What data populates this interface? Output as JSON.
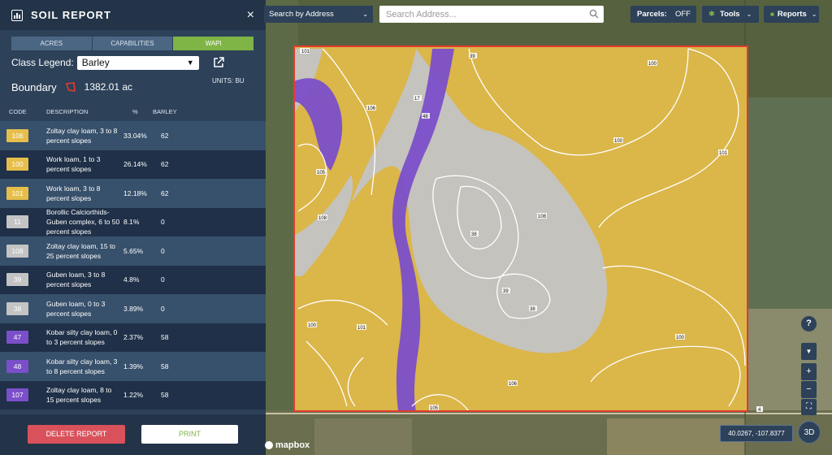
{
  "sidebar": {
    "title": "SOIL REPORT",
    "close_icon": "×",
    "tabs": [
      {
        "label": "ACRES",
        "active": false
      },
      {
        "label": "CAPABILITIES",
        "active": false
      },
      {
        "label": "WAPI",
        "active": true
      }
    ],
    "class_legend_label": "Class Legend:",
    "class_legend_value": "Barley",
    "units": "UNITS: BU",
    "boundary_label": "Boundary",
    "boundary_value": "1382.01 ac",
    "table": {
      "headers": [
        "CODE",
        "DESCRIPTION",
        "%",
        "BARLEY"
      ],
      "rows": [
        {
          "code": "106",
          "color": "#e6be4a",
          "description": "Zoltay clay loam, 3 to 8 percent slopes",
          "pct": "33.04%",
          "value": "62"
        },
        {
          "code": "100",
          "color": "#e6be4a",
          "description": "Work loam, 1 to 3 percent slopes",
          "pct": "26.14%",
          "value": "62"
        },
        {
          "code": "101",
          "color": "#e6be4a",
          "description": "Work loam, 3 to 8 percent slopes",
          "pct": "12.18%",
          "value": "62"
        },
        {
          "code": "11",
          "color": "#c4c4c4",
          "description": "Borollic Calciorthids-Guben complex, 6 to 50 percent slopes",
          "pct": "8.1%",
          "value": "0"
        },
        {
          "code": "108",
          "color": "#c4c4c4",
          "description": "Zoltay clay loam, 15 to 25 percent slopes",
          "pct": "5.65%",
          "value": "0"
        },
        {
          "code": "39",
          "color": "#c4c4c4",
          "description": "Guben loam, 3 to 8 percent slopes",
          "pct": "4.8%",
          "value": "0"
        },
        {
          "code": "38",
          "color": "#c4c4c4",
          "description": "Guben loam, 0 to 3 percent slopes",
          "pct": "3.89%",
          "value": "0"
        },
        {
          "code": "47",
          "color": "#7b4fc9",
          "description": "Kobar silty clay loam, 0 to 3 percent slopes",
          "pct": "2.37%",
          "value": "58"
        },
        {
          "code": "48",
          "color": "#7b4fc9",
          "description": "Kobar silty clay loam, 3 to 8 percent slopes",
          "pct": "1.39%",
          "value": "58"
        },
        {
          "code": "107",
          "color": "#7b4fc9",
          "description": "Zoltay clay loam, 8 to 15 percent slopes",
          "pct": "1.22%",
          "value": "58"
        }
      ]
    },
    "delete_label": "DELETE REPORT",
    "print_label": "PRINT"
  },
  "topbar": {
    "search_by": "Search by Address",
    "search_placeholder": "Search Address...",
    "parcels_label": "Parcels:",
    "parcels_value": "OFF",
    "tools_label": "Tools",
    "reports_label": "Reports"
  },
  "map": {
    "labels": [
      "101",
      "39",
      "100",
      "106",
      "48",
      "17",
      "100",
      "101",
      "105",
      "108",
      "108",
      "38",
      "39",
      "38",
      "100",
      "101",
      "100",
      "106",
      "105",
      "4"
    ],
    "coordinates": "40.0267, -107.8377",
    "btn_3d": "3D",
    "attribution": "mapbox",
    "help_icon": "?",
    "zoom_in": "+",
    "zoom_out": "−"
  },
  "colors": {
    "yellow": "#e6be4a",
    "gray": "#c4c4c4",
    "purple": "#7b4fc9",
    "boundary": "#e23b2e",
    "panel": "#2d4159",
    "green": "#7fb446"
  }
}
